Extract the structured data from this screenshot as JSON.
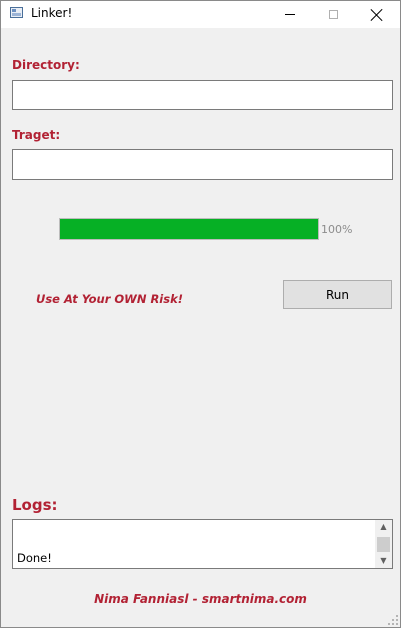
{
  "window": {
    "title": "Linker!"
  },
  "form": {
    "directory_label": "Directory:",
    "directory_value": "",
    "target_label": "Traget:",
    "target_value": ""
  },
  "progress": {
    "percent": 100,
    "text": "100%",
    "color": "#06b025"
  },
  "actions": {
    "warning": "Use At Your OWN Risk!",
    "run_label": "Run"
  },
  "logs": {
    "label": "Logs:",
    "text": "Done!"
  },
  "footer": {
    "credit": "Nima Fanniasl - smartnima.com"
  },
  "icons": {
    "app": "app-window-icon",
    "scroll_up": "scroll-up-arrow-icon",
    "scroll_down": "scroll-down-arrow-icon"
  },
  "colors": {
    "accent_text": "#b22234",
    "progress_fill": "#06b025"
  }
}
